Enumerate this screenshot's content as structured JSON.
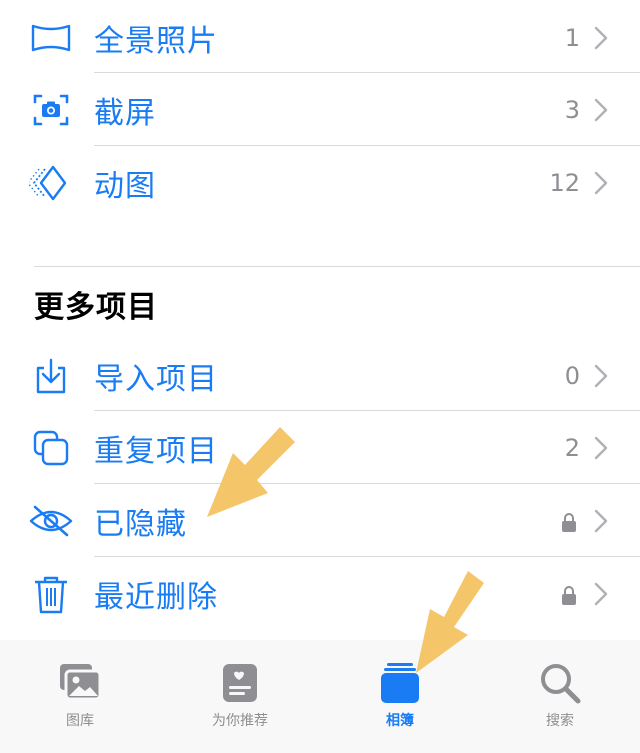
{
  "colors": {
    "accent": "#1a7cf4",
    "secondary": "#8e8e93",
    "separator": "#d9d9de",
    "annotation_arrow": "#f5c56a"
  },
  "media_types": [
    {
      "label": "全景照片",
      "count": "1",
      "icon": "panorama-icon"
    },
    {
      "label": "截屏",
      "count": "3",
      "icon": "screenshot-icon"
    },
    {
      "label": "动图",
      "count": "12",
      "icon": "animated-icon"
    }
  ],
  "more_items": {
    "title": "更多项目",
    "items": [
      {
        "label": "导入项目",
        "count": "0",
        "icon": "import-icon"
      },
      {
        "label": "重复项目",
        "count": "2",
        "icon": "duplicate-icon"
      },
      {
        "label": "已隐藏",
        "locked": true,
        "icon": "eye-slash-icon"
      },
      {
        "label": "最近删除",
        "locked": true,
        "icon": "trash-icon"
      }
    ]
  },
  "tabbar": {
    "tabs": [
      {
        "label": "图库",
        "icon": "photos-library-icon",
        "active": false
      },
      {
        "label": "为你推荐",
        "icon": "for-you-icon",
        "active": false
      },
      {
        "label": "相簿",
        "icon": "albums-icon",
        "active": true
      },
      {
        "label": "搜索",
        "icon": "search-icon",
        "active": false
      }
    ]
  }
}
